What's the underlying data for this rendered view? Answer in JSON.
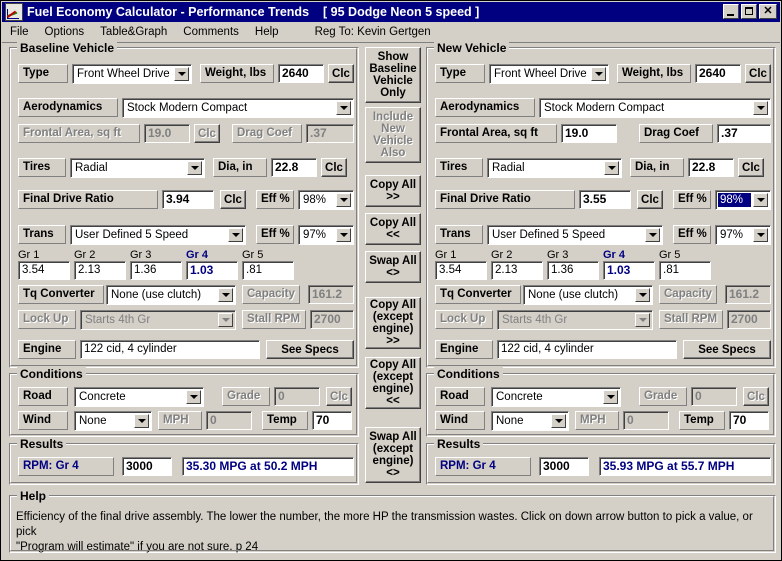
{
  "window": {
    "title": "Fuel Economy Calculator - Performance Trends",
    "subtitle": "[ 95 Dodge Neon 5 speed ]",
    "minimize": "_",
    "maximize": "□",
    "close": "✕"
  },
  "menu": {
    "items": [
      "File",
      "Options",
      "Table&Graph",
      "Comments",
      "Help"
    ],
    "reg_to": "Reg To: Kevin Gertgen"
  },
  "middle_buttons": [
    {
      "label": "Show\nBaseline\nVehicle\nOnly",
      "disabled": false
    },
    {
      "label": "Include\nNew\nVehicle\nAlso",
      "disabled": true
    },
    {
      "label": "Copy All\n>>",
      "disabled": false
    },
    {
      "label": "Copy All\n<<",
      "disabled": false
    },
    {
      "label": "Swap All\n<>",
      "disabled": false
    },
    {
      "label": "Copy All\n(except\nengine)\n>>",
      "disabled": false
    },
    {
      "label": "Copy All\n(except\nengine)\n<<",
      "disabled": false
    },
    {
      "label": "Swap All\n(except\nengine)\n<>",
      "disabled": false
    }
  ],
  "baseline": {
    "group_title": "Baseline Vehicle",
    "type_label": "Type",
    "type_value": "Front Wheel Drive",
    "weight_label": "Weight, lbs",
    "weight_value": "2640",
    "weight_clc": "Clc",
    "aero_label": "Aerodynamics",
    "aero_value": "Stock Modern Compact",
    "frontal_label": "Frontal Area, sq ft",
    "frontal_value": "19.0",
    "frontal_clc": "Clc",
    "drag_label": "Drag Coef",
    "drag_value": ".37",
    "tires_label": "Tires",
    "tires_value": "Radial",
    "dia_label": "Dia, in",
    "dia_value": "22.8",
    "dia_clc": "Clc",
    "fdr_label": "Final Drive Ratio",
    "fdr_value": "3.94",
    "fdr_clc": "Clc",
    "fdr_eff_label": "Eff %",
    "fdr_eff_value": "98%",
    "trans_label": "Trans",
    "trans_value": "User Defined 5 Speed",
    "trans_eff_label": "Eff %",
    "trans_eff_value": "97%",
    "gears": [
      {
        "label": "Gr 1",
        "value": "3.54",
        "highlight": false
      },
      {
        "label": "Gr 2",
        "value": "2.13",
        "highlight": false
      },
      {
        "label": "Gr 3",
        "value": "1.36",
        "highlight": false
      },
      {
        "label": "Gr 4",
        "value": "1.03",
        "highlight": true
      },
      {
        "label": "Gr 5",
        "value": ".81",
        "highlight": false
      }
    ],
    "tq_label": "Tq Converter",
    "tq_value": "None (use clutch)",
    "capacity_label": "Capacity",
    "capacity_value": "161.2",
    "lockup_label": "Lock Up",
    "lockup_value": "Starts 4th Gr",
    "stall_label": "Stall RPM",
    "stall_value": "2700",
    "engine_label": "Engine",
    "engine_value": "122 cid, 4 cylinder",
    "see_specs": "See Specs",
    "conditions": {
      "group_title": "Conditions",
      "road_label": "Road",
      "road_value": "Concrete",
      "grade_label": "Grade",
      "grade_value": "0",
      "grade_clc": "Clc",
      "wind_label": "Wind",
      "wind_value": "None",
      "mph_label": "MPH",
      "mph_value": "0",
      "temp_label": "Temp",
      "temp_value": "70"
    },
    "results": {
      "group_title": "Results",
      "rpm_label": "RPM: Gr 4",
      "rpm_value": "3000",
      "summary": "35.30 MPG at 50.2 MPH"
    }
  },
  "newvehicle": {
    "group_title": "New Vehicle",
    "type_label": "Type",
    "type_value": "Front Wheel Drive",
    "weight_label": "Weight, lbs",
    "weight_value": "2640",
    "weight_clc": "Clc",
    "aero_label": "Aerodynamics",
    "aero_value": "Stock Modern Compact",
    "frontal_label": "Frontal Area, sq ft",
    "frontal_value": "19.0",
    "drag_label": "Drag Coef",
    "drag_value": ".37",
    "tires_label": "Tires",
    "tires_value": "Radial",
    "dia_label": "Dia, in",
    "dia_value": "22.8",
    "dia_clc": "Clc",
    "fdr_label": "Final Drive Ratio",
    "fdr_value": "3.55",
    "fdr_clc": "Clc",
    "fdr_eff_label": "Eff %",
    "fdr_eff_value": "98%",
    "trans_label": "Trans",
    "trans_value": "User Defined 5 Speed",
    "trans_eff_label": "Eff %",
    "trans_eff_value": "97%",
    "gears": [
      {
        "label": "Gr 1",
        "value": "3.54",
        "highlight": false
      },
      {
        "label": "Gr 2",
        "value": "2.13",
        "highlight": false
      },
      {
        "label": "Gr 3",
        "value": "1.36",
        "highlight": false
      },
      {
        "label": "Gr 4",
        "value": "1.03",
        "highlight": true
      },
      {
        "label": "Gr 5",
        "value": ".81",
        "highlight": false
      }
    ],
    "tq_label": "Tq Converter",
    "tq_value": "None (use clutch)",
    "capacity_label": "Capacity",
    "capacity_value": "161.2",
    "lockup_label": "Lock Up",
    "lockup_value": "Starts 4th Gr",
    "stall_label": "Stall RPM",
    "stall_value": "2700",
    "engine_label": "Engine",
    "engine_value": "122 cid, 4 cylinder",
    "see_specs": "See Specs",
    "conditions": {
      "group_title": "Conditions",
      "road_label": "Road",
      "road_value": "Concrete",
      "grade_label": "Grade",
      "grade_value": "0",
      "grade_clc": "Clc",
      "wind_label": "Wind",
      "wind_value": "None",
      "mph_label": "MPH",
      "mph_value": "0",
      "temp_label": "Temp",
      "temp_value": "70"
    },
    "results": {
      "group_title": "Results",
      "rpm_label": "RPM: Gr 4",
      "rpm_value": "3000",
      "summary": "35.93 MPG at 55.7 MPH"
    }
  },
  "help": {
    "group_title": "Help",
    "line1": "Efficiency of the final drive assembly.  The lower the number, the more HP the transmission wastes.  Click on down arrow button to pick a value, or pick",
    "line2": "\"Program will estimate\" if you are not sure.  p 24"
  },
  "colors": {
    "titlebar": "#000080",
    "face": "#d4d0c8",
    "accent_blue": "#000080",
    "disabled": "#808080"
  }
}
